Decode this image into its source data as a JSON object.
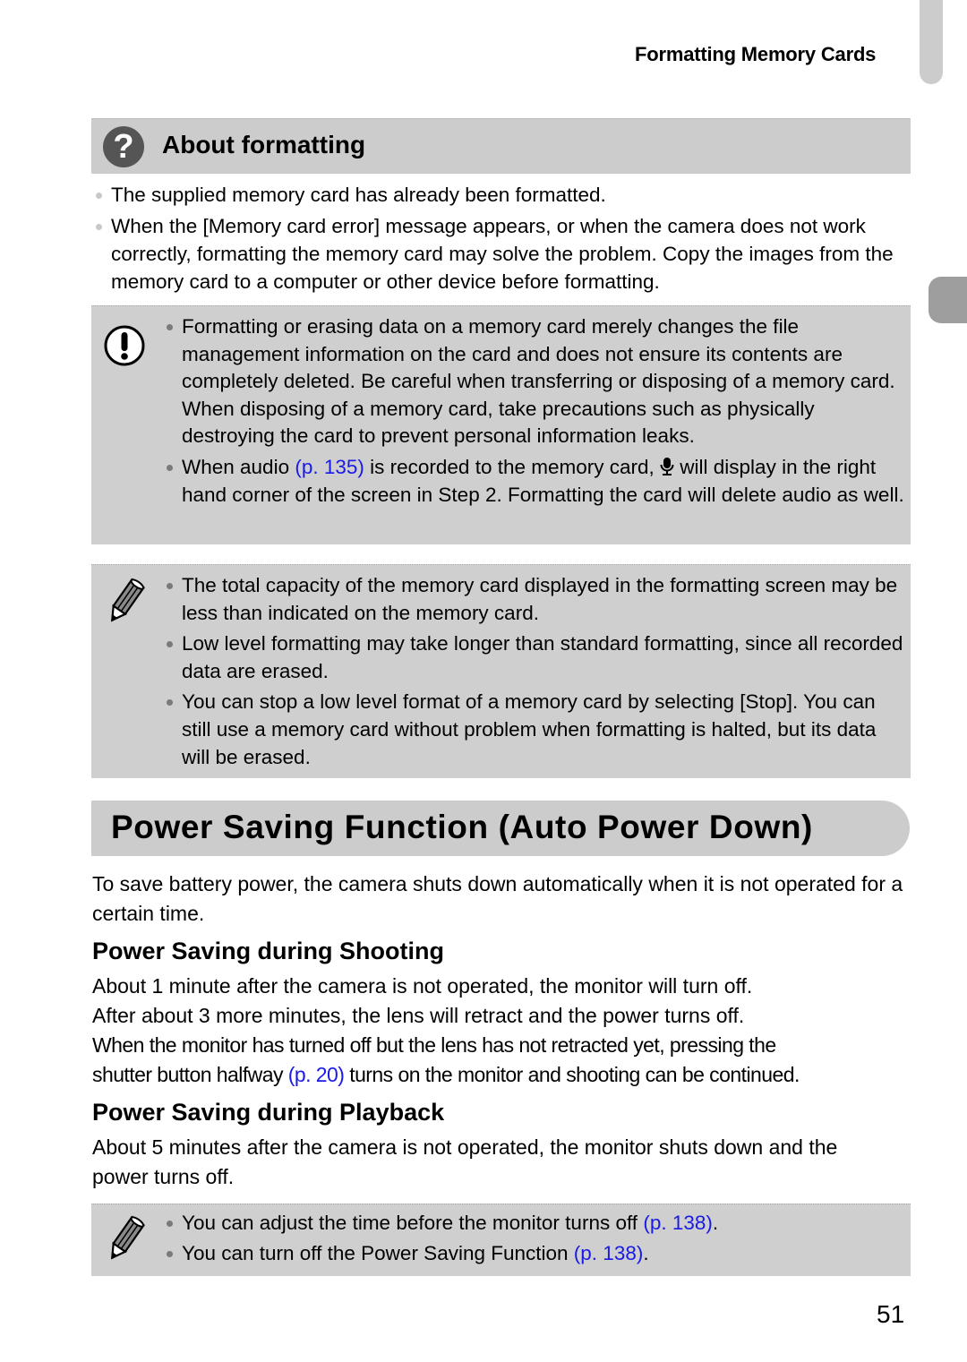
{
  "running_head": "Formatting Memory Cards",
  "about": {
    "icon": "question-icon",
    "title": "About formatting",
    "items": [
      "The supplied memory card has already been formatted.",
      "When the [Memory card error] message appears, or when the camera does not work correctly, formatting the memory card may solve the problem. Copy the images from the memory card to a computer or other device before formatting."
    ]
  },
  "caution": {
    "icon": "caution-icon",
    "items": [
      {
        "text": "Formatting or erasing data on a memory card merely changes the file management information on the card and does not ensure its contents are completely deleted. Be careful when transferring or disposing of a memory card. When disposing of a memory card, take precautions such as physically destroying the card to prevent personal information leaks."
      },
      {
        "pre": "When audio ",
        "link": "(p. 135)",
        "mid": " is recorded to the memory card, ",
        "icon": "microphone-icon",
        "post": " will display in the right hand corner of the screen in Step 2. Formatting the card will delete audio as well."
      }
    ]
  },
  "memo1": {
    "icon": "pencil-icon",
    "items": [
      "The total capacity of the memory card displayed in the formatting screen may be less than indicated on the memory card.",
      "Low level formatting may take longer than standard formatting, since all recorded data are erased.",
      "You can stop a low level format of a memory card by selecting [Stop]. You can still use a memory card without problem when formatting is halted, but its data will be erased."
    ]
  },
  "section": {
    "title": "Power Saving Function (Auto Power Down)",
    "intro": "To save battery power, the camera shuts down automatically when it is not operated for a certain time.",
    "shooting": {
      "title": "Power Saving during Shooting",
      "line1": "About 1 minute after the camera is not operated, the monitor will turn off.",
      "line2": "After about 3 more minutes, the lens will retract and the power turns off.",
      "line3": "When the monitor has turned off but the lens has not retracted yet, pressing the",
      "line4_pre": "shutter button halfway ",
      "line4_link": "(p. 20)",
      "line4_post": " turns on the monitor and shooting can be continued."
    },
    "playback": {
      "title": "Power Saving during Playback",
      "text": "About 5 minutes after the camera is not operated, the monitor shuts down and the power turns off."
    }
  },
  "memo2": {
    "icon": "pencil-icon",
    "items": [
      {
        "pre": "You can adjust the time before the monitor turns off ",
        "link": "(p. 138)",
        "post": "."
      },
      {
        "pre": "You can turn off the Power Saving Function ",
        "link": "(p. 138)",
        "post": "."
      }
    ]
  },
  "page_number": "51"
}
